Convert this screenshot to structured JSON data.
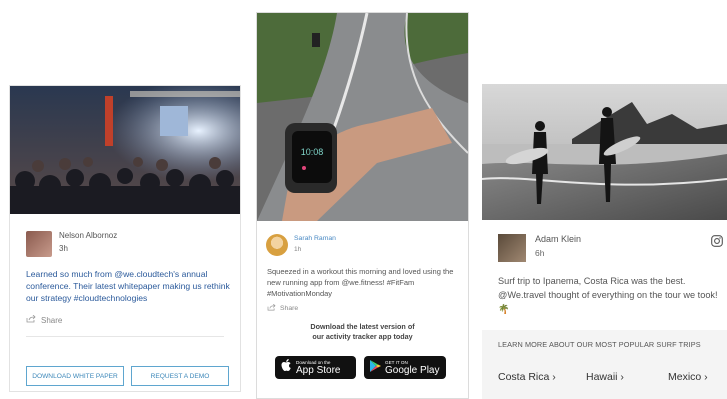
{
  "card1": {
    "author": "Nelson Albornoz",
    "time": "3h",
    "post": "Learned so much from @we.cloudtech's annual conference. Their latest whitepaper making us rethink our strategy #cloudtechnologies",
    "share": "Share",
    "btn_download": "DOWNLOAD WHITE PAPER",
    "btn_demo": "REQUEST A DEMO",
    "accent": "#3c87b9"
  },
  "card2": {
    "author": "Sarah Raman",
    "time": "1h",
    "post": "Squeezed in a workout this morning and loved using the new running app from @we.fitness! #FitFam #MotivationMonday",
    "share": "Share",
    "cta_line1": "Download the latest version of",
    "cta_line2": "our activity tracker app today",
    "appstore_small": "Download on the",
    "appstore_big": "App Store",
    "googleplay_small": "GET IT ON",
    "googleplay_big": "Google Play"
  },
  "card3": {
    "author": "Adam Klein",
    "time": "6h",
    "post": "Surf trip to Ipanema, Costa Rica was the best. @We.travel thought of everything on the tour we took! 🌴",
    "learn_more": "LEARN MORE ABOUT OUR MOST POPULAR SURF TRIPS",
    "destinations": [
      "Costa Rica ›",
      "Hawaii ›",
      "Mexico ›"
    ]
  },
  "icons": [
    "share-icon",
    "apple-icon",
    "google-play-icon",
    "instagram-icon"
  ]
}
